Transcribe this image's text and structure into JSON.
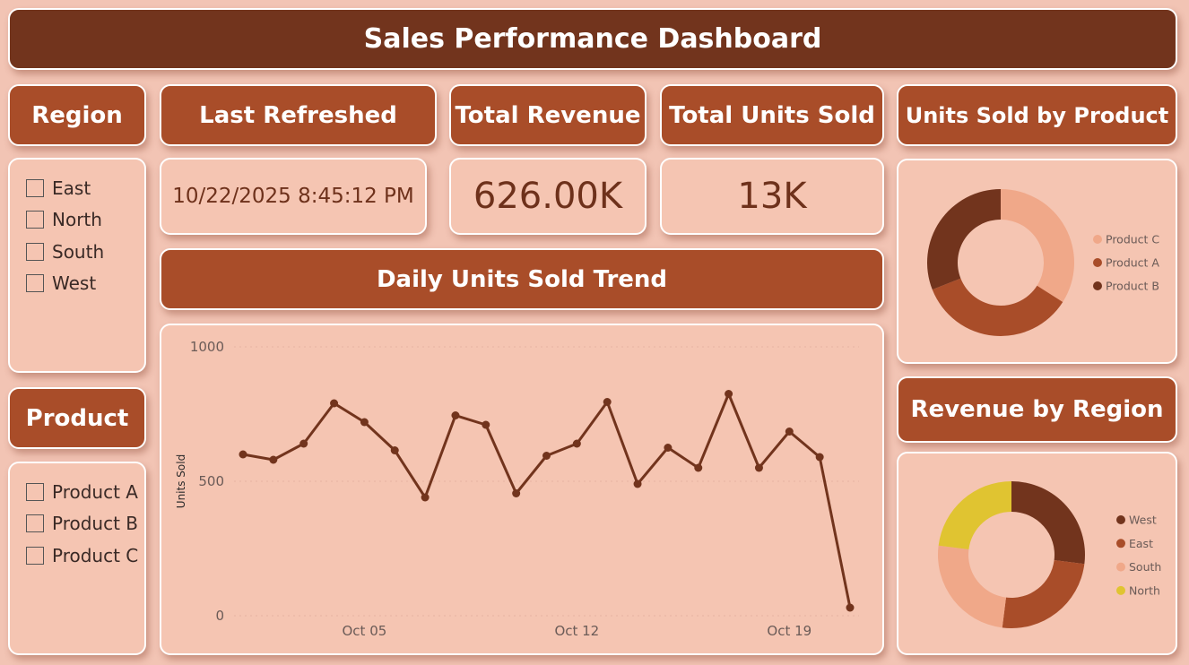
{
  "header": {
    "title": "Sales Performance Dashboard"
  },
  "filters": {
    "region": {
      "title": "Region",
      "options": [
        "East",
        "North",
        "South",
        "West"
      ]
    },
    "product": {
      "title": "Product",
      "options": [
        "Product A",
        "Product B",
        "Product C"
      ]
    }
  },
  "kpis": {
    "last_refreshed": {
      "title": "Last Refreshed",
      "value": "10/22/2025 8:45:12 PM"
    },
    "total_revenue": {
      "title": "Total Revenue",
      "value": "626.00K"
    },
    "total_units": {
      "title": "Total Units Sold",
      "value": "13K"
    }
  },
  "colors": {
    "header_bg": "#72341d",
    "tile_bg": "#a94d29",
    "page_bg": "#f2c4b4",
    "line": "#72341d",
    "product_a": "#a94d29",
    "product_b": "#72341d",
    "product_c": "#f0a889",
    "west": "#72341d",
    "east": "#a94d29",
    "south": "#f0a889",
    "north": "#e0c431"
  },
  "chart_data": [
    {
      "id": "daily_units",
      "type": "line",
      "title": "Daily Units Sold Trend",
      "xlabel": "",
      "ylabel": "Units Sold",
      "ylim": [
        0,
        1000
      ],
      "yticks": [
        0,
        500,
        1000
      ],
      "x_tick_labels": [
        "Oct 05",
        "Oct 12",
        "Oct 19"
      ],
      "x_tick_index": [
        4,
        11,
        18
      ],
      "x": [
        "Oct 01",
        "Oct 02",
        "Oct 03",
        "Oct 04",
        "Oct 05",
        "Oct 06",
        "Oct 07",
        "Oct 08",
        "Oct 09",
        "Oct 10",
        "Oct 11",
        "Oct 12",
        "Oct 13",
        "Oct 14",
        "Oct 15",
        "Oct 16",
        "Oct 17",
        "Oct 18",
        "Oct 19",
        "Oct 20",
        "Oct 21"
      ],
      "values": [
        600,
        580,
        640,
        790,
        720,
        615,
        440,
        745,
        710,
        455,
        595,
        640,
        795,
        490,
        625,
        550,
        825,
        550,
        685,
        590,
        30
      ],
      "grid": true
    },
    {
      "id": "units_by_product",
      "type": "pie",
      "title": "Units Sold by Product",
      "legend": "right",
      "labels": [
        "Product C",
        "Product A",
        "Product B"
      ],
      "values": [
        34,
        35,
        31
      ]
    },
    {
      "id": "revenue_by_region",
      "type": "pie",
      "title": "Revenue by Region",
      "legend": "right",
      "labels": [
        "West",
        "East",
        "South",
        "North"
      ],
      "values": [
        27,
        25,
        25,
        23
      ]
    }
  ]
}
